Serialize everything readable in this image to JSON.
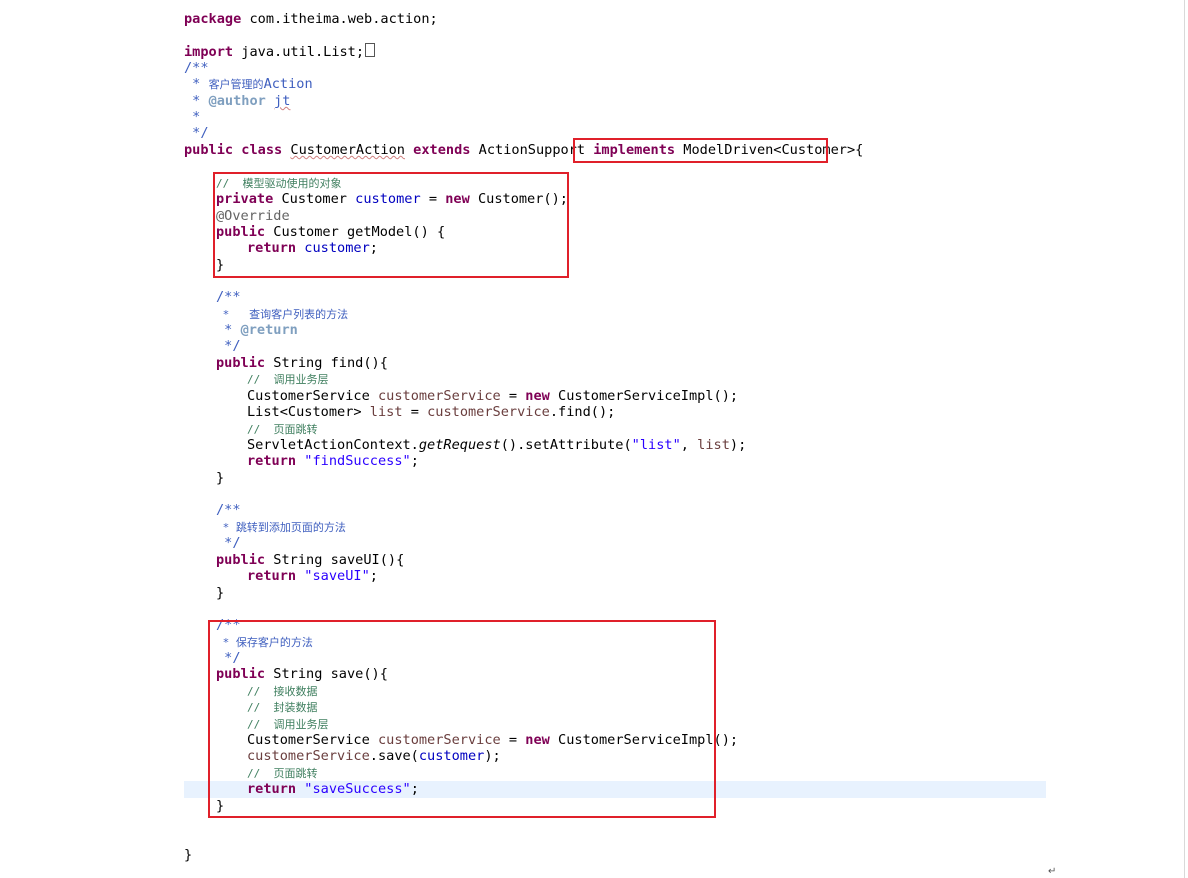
{
  "code": {
    "pkg_kw": "package",
    "pkg_name": " com.itheima.web.action;",
    "import_kw": "import",
    "import_name": " java.util.List;",
    "jd_open": "/**",
    "cls_jd_star1": " * ",
    "cls_jd_desc_cn": "客户管理的",
    "cls_jd_desc_en": "Action",
    "cls_jd_star2": " * ",
    "cls_jd_author_tag": "@author",
    "cls_jd_author_name": "jt",
    "cls_jd_star3": " *",
    "cls_jd_close": " */",
    "public_kw": "public",
    "class_kw": "class",
    "class_name": "CustomerAction",
    "extends_kw": "extends",
    "super_name": "ActionSupport",
    "implements_kw": "implements",
    "iface_name": "ModelDriven<Customer>",
    "open_brace": "{",
    "model_comment": "//  模型驱动使用的对象",
    "private_kw": "private",
    "customer_type": "Customer",
    "customer_field": "customer",
    "assign": " = ",
    "new_kw": "new",
    "customer_ctor": "Customer();",
    "override": "@Override",
    "get_model_sig": "Customer getModel() {",
    "return_kw": "return",
    "semicolon": ";",
    "close_brace": "}",
    "find_jd_open": "/**",
    "find_jd_desc": " *   查询客户列表的方法",
    "find_jd_return_star": " * ",
    "find_jd_return_tag": "@return",
    "find_jd_close": " */",
    "string_type": "String",
    "find_sig": "find(){",
    "comment_call_service": "//  调用业务层",
    "service_type": "CustomerService",
    "service_var": "customerService",
    "service_impl_ctor": "CustomerServiceImpl();",
    "list_type": "List<Customer>",
    "list_var": "list",
    "service_find_call": ".find();",
    "comment_page_jump": "//  页面跳转",
    "servlet_ctx": "ServletActionContext.",
    "get_request": "getRequest",
    "set_attr": "().setAttribute(",
    "str_list": "\"list\"",
    "comma": ", ",
    "set_attr_close": ");",
    "str_find_success": "\"findSuccess\"",
    "saveui_jd_open": "/**",
    "saveui_jd_desc": " * 跳转到添加页面的方法",
    "saveui_jd_close": " */",
    "saveui_sig": "saveUI(){",
    "str_saveui": "\"saveUI\"",
    "save_jd_open": "/**",
    "save_jd_desc": " * 保存客户的方法",
    "save_jd_close": " */",
    "save_sig": "save(){",
    "comment_receive": "//  接收数据",
    "comment_wrap": "//  封装数据",
    "comment_call_service2": "//  调用业务层",
    "service_save_call": ".save(",
    "save_arg": "customer",
    "save_call_close": ");",
    "comment_page_jump2": "//  页面跳转",
    "str_save_success": "\"saveSuccess\"",
    "final_brace": "}",
    "para_mark": "↵"
  }
}
